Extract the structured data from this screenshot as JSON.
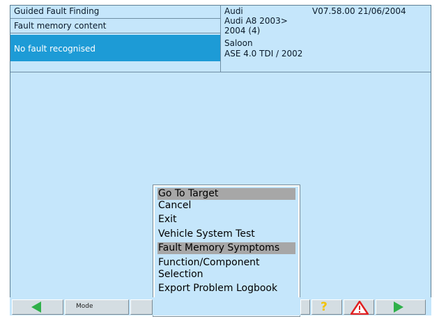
{
  "header": {
    "left": {
      "title": "Guided Fault Finding",
      "subtitle": "Fault memory content",
      "status": "No fault recognised"
    },
    "right": {
      "make": "Audi",
      "version": "V07.58.00 21/06/2004",
      "model": "Audi A8 2003>",
      "year": "2004 (4)",
      "body": "Saloon",
      "engine": "ASE 4.0 TDI / 2002"
    }
  },
  "menu": {
    "items": [
      {
        "label": "Go To Target",
        "highlight": true
      },
      {
        "label": "Cancel",
        "highlight": false
      },
      {
        "label": "Exit",
        "highlight": false
      },
      {
        "label": "Vehicle System Test",
        "highlight": false
      },
      {
        "label": "Fault Memory Symptoms",
        "highlight": true
      },
      {
        "label": "Function/Component\nSelection",
        "highlight": false
      },
      {
        "label": "Export Problem Logbook",
        "highlight": false
      }
    ]
  },
  "toolbar": {
    "mode_label": "Mode",
    "back_icon": "back-arrow-icon",
    "help_icon": "help-question-icon",
    "warning_icon": "warning-triangle-icon",
    "forward_icon": "forward-arrow-icon"
  },
  "colors": {
    "panel": "#c5e6fb",
    "selected": "#1d9bd6",
    "arrow": "#2fb04a",
    "warning": "#e02020",
    "help": "#f2c200"
  }
}
